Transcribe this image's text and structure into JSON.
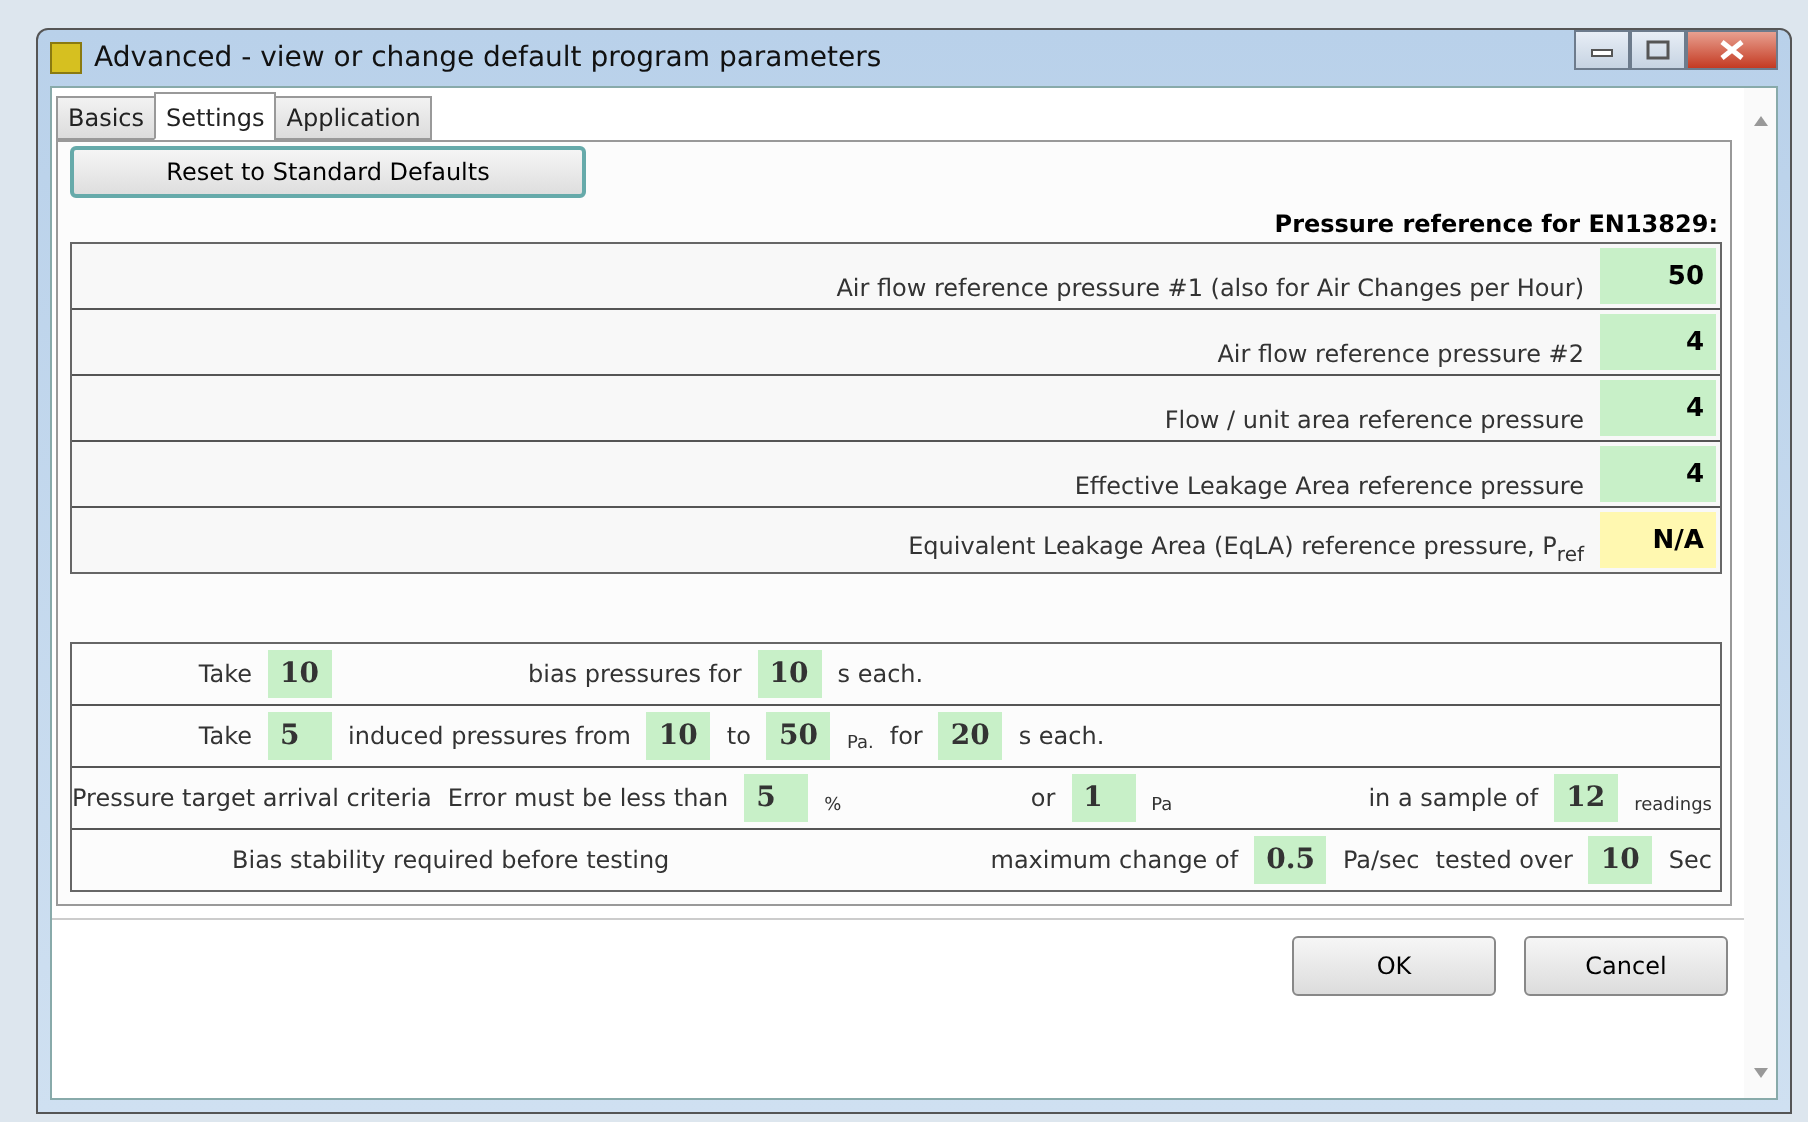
{
  "window": {
    "title": "Advanced - view or change default program parameters"
  },
  "tabs": [
    {
      "label": "Basics",
      "selected": false
    },
    {
      "label": "Settings",
      "selected": true
    },
    {
      "label": "Application",
      "selected": false
    }
  ],
  "reset_button": "Reset to Standard Defaults",
  "reference_heading": "Pressure reference for EN13829:",
  "references": [
    {
      "label": "Air flow reference pressure #1 (also for Air Changes per Hour)",
      "value": "50",
      "color": "#c8f0c8"
    },
    {
      "label": "Air flow reference pressure #2",
      "value": "4",
      "color": "#c8f0c8"
    },
    {
      "label": "Flow / unit area reference pressure",
      "value": "4",
      "color": "#c8f0c8"
    },
    {
      "label": "Effective Leakage Area reference pressure",
      "value": "4",
      "color": "#c8f0c8"
    },
    {
      "label": "Equivalent Leakage Area (EqLA) reference pressure, P$_{ref}$",
      "value": "N/A",
      "color": "#fff8b0"
    }
  ],
  "test_rows": [
    {
      "segments": [
        {
          "kind": "lead",
          "text": "Take"
        },
        {
          "kind": "value",
          "text": "10"
        },
        {
          "kind": "spaced",
          "text": "bias pressures for"
        },
        {
          "kind": "value",
          "text": "10"
        },
        {
          "kind": "text",
          "text": "s each."
        }
      ]
    },
    {
      "segments": [
        {
          "kind": "lead",
          "text": "Take"
        },
        {
          "kind": "value",
          "text": "5"
        },
        {
          "kind": "text",
          "text": "induced pressures from"
        },
        {
          "kind": "value",
          "text": "10"
        },
        {
          "kind": "text",
          "text": "to"
        },
        {
          "kind": "value",
          "text": "50"
        },
        {
          "kind": "unit",
          "text": "Pa."
        },
        {
          "kind": "text",
          "text": "for"
        },
        {
          "kind": "value",
          "text": "20"
        },
        {
          "kind": "text",
          "text": "s each."
        }
      ]
    },
    {
      "segments": [
        {
          "kind": "text",
          "text": "Pressure target arrival criteria"
        },
        {
          "kind": "text",
          "text": "Error must be less than"
        },
        {
          "kind": "value",
          "text": "5"
        },
        {
          "kind": "unit",
          "text": "%"
        },
        {
          "kind": "wide",
          "text": "or"
        },
        {
          "kind": "value",
          "text": "1"
        },
        {
          "kind": "unit",
          "text": "Pa"
        },
        {
          "kind": "spaced",
          "text": "in a sample of"
        },
        {
          "kind": "value",
          "text": "12"
        },
        {
          "kind": "unit",
          "text": "readings"
        }
      ]
    },
    {
      "segments": [
        {
          "kind": "centered",
          "text": "Bias stability required before testing"
        },
        {
          "kind": "wide",
          "text": "maximum change of"
        },
        {
          "kind": "value",
          "text": "0.5"
        },
        {
          "kind": "text",
          "text": "Pa/sec"
        },
        {
          "kind": "text",
          "text": "tested over"
        },
        {
          "kind": "value",
          "text": "10"
        },
        {
          "kind": "text",
          "text": "Sec"
        }
      ]
    }
  ],
  "buttons": [
    "OK",
    "Cancel"
  ]
}
